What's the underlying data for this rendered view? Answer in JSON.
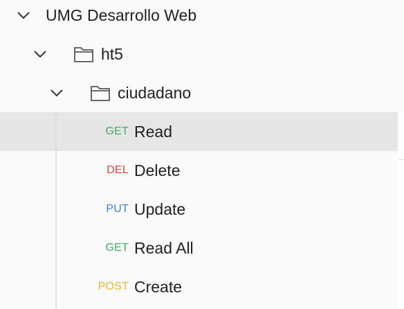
{
  "collection": {
    "name": "UMG Desarrollo Web",
    "expanded": true,
    "folder": {
      "name": "ht5",
      "expanded": true,
      "subfolder": {
        "name": "ciudadano",
        "expanded": true
      }
    }
  },
  "requests": [
    {
      "method": "GET",
      "name": "Read",
      "method_color": "#3cae60",
      "selected": true
    },
    {
      "method": "DEL",
      "name": "Delete",
      "method_color": "#e0463a",
      "selected": false
    },
    {
      "method": "PUT",
      "name": "Update",
      "method_color": "#3d7fd9",
      "selected": false
    },
    {
      "method": "GET",
      "name": "Read All",
      "method_color": "#3cae60",
      "selected": false
    },
    {
      "method": "POST",
      "name": "Create",
      "method_color": "#ecb629",
      "selected": false
    }
  ],
  "icons": {
    "chevron": "chevron-down-icon",
    "folder": "folder-icon"
  }
}
